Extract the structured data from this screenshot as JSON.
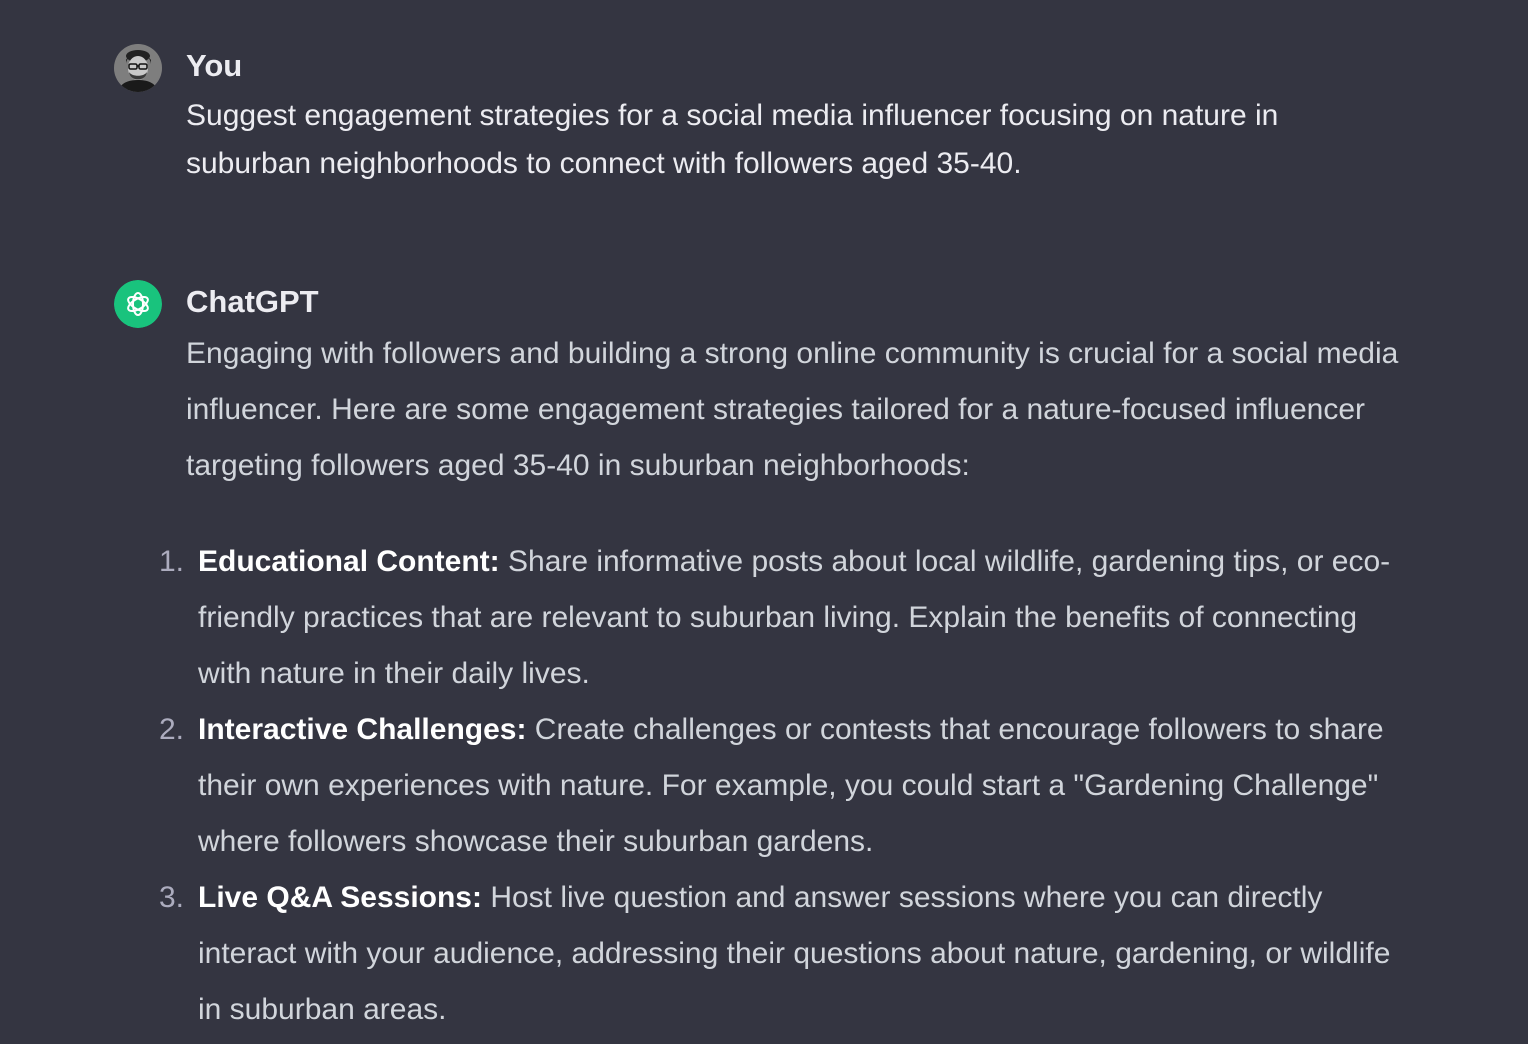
{
  "conversation": {
    "user_message": {
      "author": "You",
      "avatar_icon": "user-photo-avatar",
      "text": "Suggest engagement strategies for a social media influencer focusing on nature in suburban neighborhoods to connect with followers aged 35-40."
    },
    "assistant_message": {
      "author": "ChatGPT",
      "avatar_icon": "openai-logo-icon",
      "avatar_color": "#19c37d",
      "intro": "Engaging with followers and building a strong online community is crucial for a social media influencer. Here are some engagement strategies tailored for a nature-focused influencer targeting followers aged 35-40 in suburban neighborhoods:",
      "steps": [
        {
          "number": "1.",
          "title": "Educational Content:",
          "text": "Share informative posts about local wildlife, gardening tips, or eco-friendly practices that are relevant to suburban living. Explain the benefits of connecting with nature in their daily lives."
        },
        {
          "number": "2.",
          "title": "Interactive Challenges:",
          "text": "Create challenges or contests that encourage followers to share their own experiences with nature. For example, you could start a \"Gardening Challenge\" where followers showcase their suburban gardens."
        },
        {
          "number": "3.",
          "title": "Live Q&A Sessions:",
          "text": "Host live question and answer sessions where you can directly interact with your audience, addressing their questions about nature, gardening, or wildlife in suburban areas."
        }
      ]
    }
  },
  "colors": {
    "background": "#343541",
    "text_primary": "#ececf1",
    "text_body": "#d1d5db",
    "accent": "#19c37d"
  }
}
